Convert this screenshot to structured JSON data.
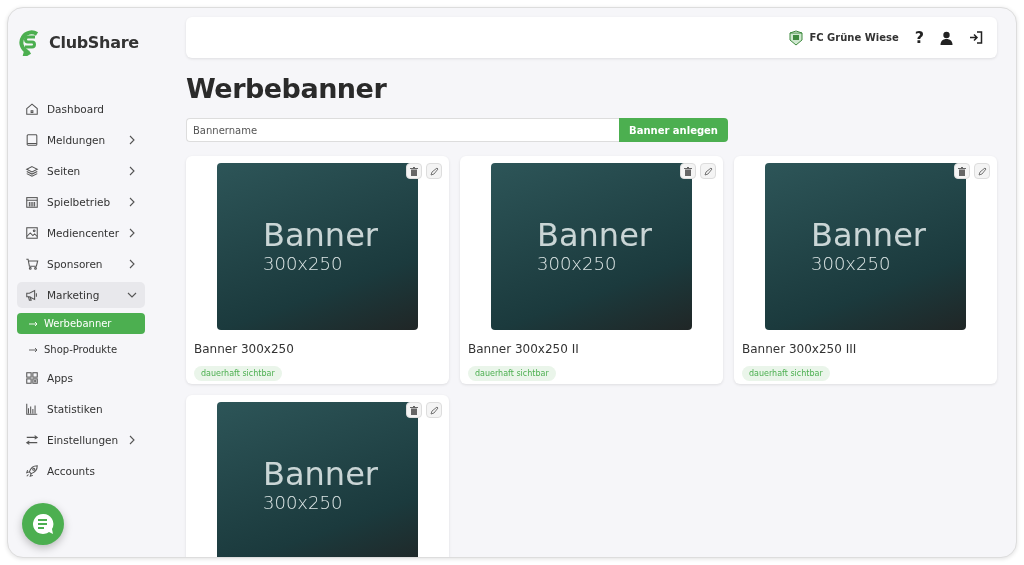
{
  "brand": {
    "name": "ClubShare"
  },
  "sidebar": {
    "items": [
      {
        "label": "Dashboard",
        "selected": false
      },
      {
        "label": "Meldungen",
        "expanded": false,
        "selected": false
      },
      {
        "label": "Seiten",
        "expanded": false,
        "selected": false
      },
      {
        "label": "Spielbetrieb",
        "expanded": false,
        "selected": false
      },
      {
        "label": "Mediencenter",
        "expanded": false,
        "selected": false
      },
      {
        "label": "Sponsoren",
        "expanded": false,
        "selected": false
      },
      {
        "label": "Marketing",
        "expanded": true,
        "selected": true,
        "children": [
          {
            "label": "Werbebanner",
            "selected": true
          },
          {
            "label": "Shop-Produkte",
            "selected": false
          }
        ]
      },
      {
        "label": "Apps",
        "selected": false
      },
      {
        "label": "Statistiken",
        "selected": false
      },
      {
        "label": "Einstellungen",
        "expanded": false,
        "selected": false
      },
      {
        "label": "Accounts",
        "selected": false
      }
    ]
  },
  "topbar": {
    "club": "FC Grüne Wiese",
    "help": "?"
  },
  "page": {
    "title": "Werbebanner"
  },
  "create_form": {
    "placeholder": "Bannername",
    "button": "Banner anlegen"
  },
  "banners": [
    {
      "image_title": "Banner",
      "image_size": "300x250",
      "name": "Banner 300x250",
      "tag": "dauerhaft sichtbar"
    },
    {
      "image_title": "Banner",
      "image_size": "300x250",
      "name": "Banner 300x250 II",
      "tag": "dauerhaft sichtbar"
    },
    {
      "image_title": "Banner",
      "image_size": "300x250",
      "name": "Banner 300x250 III",
      "tag": "dauerhaft sichtbar"
    },
    {
      "image_title": "Banner",
      "image_size": "300x250"
    }
  ]
}
